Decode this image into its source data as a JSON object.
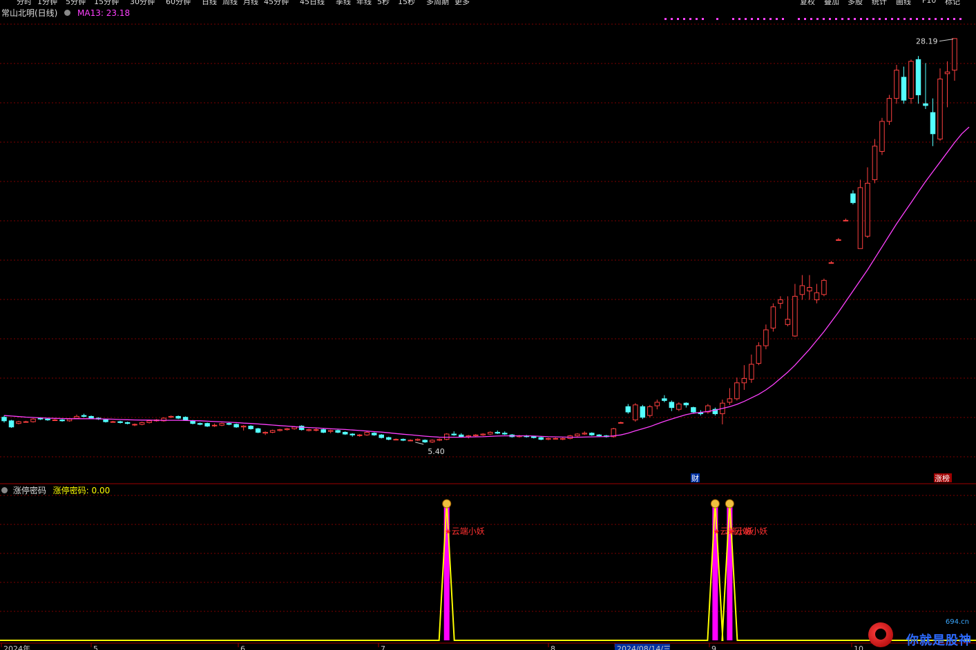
{
  "menu": {
    "items": [
      "分时",
      "1分钟",
      "5分钟",
      "15分钟",
      "30分钟",
      "60分钟",
      "日线",
      "周线",
      "月线",
      "45分钟",
      "45日线",
      "季线",
      "年线",
      "5秒",
      "15秒",
      "多周期",
      "更多"
    ],
    "right_buttons": [
      "复权",
      "叠加",
      "多股",
      "统计",
      "画线",
      "F10",
      "标记"
    ]
  },
  "header": {
    "stock_name": "常山北明(日线)",
    "ma_label": "MA13: 23.18"
  },
  "sub_panel": {
    "name": "涨停密码",
    "value_label": "涨停密码: 0.00"
  },
  "watermark": {
    "url": "694.cn",
    "text": "你就是股神"
  },
  "chart_data": [
    {
      "type": "candlestick",
      "title": "常山北明(日线)",
      "indicator": {
        "name": "MA13",
        "value": 23.18,
        "color": "#ff40ff"
      },
      "ylim": [
        4.2,
        29.2
      ],
      "grid": true,
      "colors": {
        "up": "#ff4040",
        "down": "#54ffff",
        "ma": "#ff40ff",
        "grid": "#800000"
      },
      "annotations": {
        "high": "28.19",
        "low": "5.40",
        "event_1": "财",
        "event_2": "涨榜"
      },
      "x_ticks": [
        "2024年",
        "5",
        "6",
        "7",
        "8",
        "2024/08/14/三",
        "9",
        "10"
      ],
      "candles": [
        [
          6.75,
          6.85,
          6.45,
          6.55
        ],
        [
          6.55,
          6.6,
          6.15,
          6.2
        ],
        [
          6.4,
          6.55,
          6.35,
          6.5
        ],
        [
          6.5,
          6.55,
          6.45,
          6.5
        ],
        [
          6.5,
          6.7,
          6.45,
          6.65
        ],
        [
          6.7,
          6.75,
          6.6,
          6.65
        ],
        [
          6.65,
          6.7,
          6.55,
          6.6
        ],
        [
          6.6,
          6.65,
          6.55,
          6.6
        ],
        [
          6.6,
          6.65,
          6.5,
          6.55
        ],
        [
          6.55,
          6.7,
          6.5,
          6.65
        ],
        [
          6.7,
          6.9,
          6.65,
          6.8
        ],
        [
          6.85,
          6.95,
          6.75,
          6.8
        ],
        [
          6.8,
          6.85,
          6.65,
          6.7
        ],
        [
          6.7,
          6.75,
          6.6,
          6.65
        ],
        [
          6.6,
          6.65,
          6.45,
          6.5
        ],
        [
          6.5,
          6.55,
          6.45,
          6.5
        ],
        [
          6.5,
          6.55,
          6.4,
          6.45
        ],
        [
          6.45,
          6.5,
          6.35,
          6.4
        ],
        [
          6.35,
          6.4,
          6.25,
          6.35
        ],
        [
          6.35,
          6.5,
          6.3,
          6.45
        ],
        [
          6.45,
          6.6,
          6.4,
          6.55
        ],
        [
          6.55,
          6.65,
          6.5,
          6.6
        ],
        [
          6.55,
          6.75,
          6.5,
          6.7
        ],
        [
          6.75,
          6.85,
          6.7,
          6.8
        ],
        [
          6.8,
          6.85,
          6.65,
          6.7
        ],
        [
          6.75,
          6.8,
          6.55,
          6.6
        ],
        [
          6.55,
          6.6,
          6.35,
          6.4
        ],
        [
          6.4,
          6.45,
          6.3,
          6.35
        ],
        [
          6.4,
          6.45,
          6.2,
          6.25
        ],
        [
          6.3,
          6.4,
          6.2,
          6.3
        ],
        [
          6.3,
          6.45,
          6.25,
          6.4
        ],
        [
          6.4,
          6.45,
          6.3,
          6.35
        ],
        [
          6.35,
          6.4,
          6.15,
          6.2
        ],
        [
          6.2,
          6.3,
          6.0,
          6.25
        ],
        [
          6.25,
          6.3,
          6.05,
          6.1
        ],
        [
          6.1,
          6.15,
          5.85,
          5.9
        ],
        [
          5.85,
          5.95,
          5.75,
          5.9
        ],
        [
          5.9,
          6.05,
          5.85,
          6.0
        ],
        [
          6.0,
          6.1,
          5.95,
          6.05
        ],
        [
          6.05,
          6.15,
          6.0,
          6.1
        ],
        [
          6.1,
          6.25,
          6.05,
          6.2
        ],
        [
          6.25,
          6.3,
          6.0,
          6.05
        ],
        [
          6.0,
          6.1,
          5.95,
          6.05
        ],
        [
          6.05,
          6.15,
          5.95,
          6.05
        ],
        [
          6.05,
          6.1,
          5.85,
          5.9
        ],
        [
          5.95,
          6.05,
          5.85,
          6.0
        ],
        [
          6.0,
          6.05,
          5.85,
          5.9
        ],
        [
          5.9,
          5.95,
          5.75,
          5.8
        ],
        [
          5.8,
          5.85,
          5.65,
          5.75
        ],
        [
          5.75,
          5.8,
          5.65,
          5.75
        ],
        [
          5.75,
          5.95,
          5.7,
          5.9
        ],
        [
          5.85,
          5.9,
          5.7,
          5.75
        ],
        [
          5.75,
          5.8,
          5.55,
          5.6
        ],
        [
          5.6,
          5.65,
          5.45,
          5.5
        ],
        [
          5.5,
          5.55,
          5.45,
          5.5
        ],
        [
          5.5,
          5.55,
          5.4,
          5.45
        ],
        [
          5.45,
          5.5,
          5.4,
          5.45
        ],
        [
          5.45,
          5.55,
          5.4,
          5.5
        ],
        [
          5.45,
          5.5,
          5.3,
          5.35
        ],
        [
          5.35,
          5.5,
          5.3,
          5.45
        ],
        [
          5.45,
          5.55,
          5.4,
          5.5
        ],
        [
          5.5,
          5.85,
          5.45,
          5.8
        ],
        [
          5.8,
          5.95,
          5.7,
          5.75
        ],
        [
          5.75,
          5.85,
          5.6,
          5.65
        ],
        [
          5.65,
          5.75,
          5.55,
          5.7
        ],
        [
          5.7,
          5.8,
          5.65,
          5.75
        ],
        [
          5.75,
          5.85,
          5.7,
          5.8
        ],
        [
          5.8,
          5.95,
          5.75,
          5.9
        ],
        [
          5.9,
          6.0,
          5.8,
          5.85
        ],
        [
          5.85,
          5.95,
          5.75,
          5.8
        ],
        [
          5.75,
          5.8,
          5.6,
          5.65
        ],
        [
          5.65,
          5.75,
          5.6,
          5.7
        ],
        [
          5.7,
          5.75,
          5.6,
          5.65
        ],
        [
          5.65,
          5.7,
          5.55,
          5.6
        ],
        [
          5.6,
          5.65,
          5.45,
          5.5
        ],
        [
          5.5,
          5.6,
          5.45,
          5.55
        ],
        [
          5.55,
          5.6,
          5.5,
          5.55
        ],
        [
          5.5,
          5.6,
          5.45,
          5.55
        ],
        [
          5.55,
          5.75,
          5.5,
          5.7
        ],
        [
          5.7,
          5.85,
          5.65,
          5.8
        ],
        [
          5.8,
          5.95,
          5.75,
          5.85
        ],
        [
          5.85,
          5.9,
          5.7,
          5.75
        ],
        [
          5.75,
          5.8,
          5.65,
          5.7
        ],
        [
          5.7,
          5.75,
          5.6,
          5.65
        ],
        [
          5.65,
          6.15,
          5.6,
          6.1
        ],
        [
          6.45,
          6.5,
          6.4,
          6.45
        ],
        [
          7.35,
          7.5,
          6.95,
          7.05
        ],
        [
          6.6,
          7.55,
          6.5,
          7.45
        ],
        [
          7.35,
          7.45,
          6.65,
          6.75
        ],
        [
          6.85,
          7.45,
          6.75,
          7.35
        ],
        [
          7.4,
          7.75,
          7.2,
          7.6
        ],
        [
          7.8,
          8.0,
          7.6,
          7.7
        ],
        [
          7.6,
          7.7,
          7.1,
          7.3
        ],
        [
          7.2,
          7.6,
          7.1,
          7.5
        ],
        [
          7.55,
          7.6,
          7.3,
          7.45
        ],
        [
          7.3,
          7.35,
          6.95,
          7.05
        ],
        [
          7.0,
          7.15,
          6.85,
          6.95
        ],
        [
          7.05,
          7.5,
          6.95,
          7.4
        ],
        [
          7.2,
          7.3,
          6.85,
          6.95
        ],
        [
          6.95,
          7.75,
          6.35,
          7.55
        ],
        [
          7.6,
          8.4,
          7.45,
          7.8
        ],
        [
          7.8,
          9.0,
          7.7,
          8.7
        ],
        [
          8.7,
          9.7,
          8.3,
          8.95
        ],
        [
          8.9,
          10.3,
          8.7,
          9.75
        ],
        [
          9.8,
          11.0,
          9.7,
          10.8
        ],
        [
          10.8,
          12.0,
          10.6,
          11.7
        ],
        [
          11.8,
          13.2,
          11.6,
          13.0
        ],
        [
          13.2,
          13.6,
          12.9,
          13.4
        ],
        [
          12.0,
          13.6,
          11.9,
          12.3
        ],
        [
          11.35,
          14.3,
          11.3,
          13.6
        ],
        [
          13.7,
          14.8,
          13.4,
          14.2
        ],
        [
          13.9,
          14.8,
          13.4,
          14.1
        ],
        [
          13.4,
          14.3,
          13.2,
          13.8
        ],
        [
          13.7,
          14.6,
          13.6,
          14.5
        ],
        [
          15.5,
          15.6,
          15.45,
          15.5
        ],
        [
          16.8,
          16.9,
          16.75,
          16.8
        ],
        [
          17.9,
          18.0,
          17.85,
          17.9
        ],
        [
          19.4,
          19.6,
          18.8,
          18.9
        ],
        [
          16.3,
          20.2,
          16.3,
          19.75
        ],
        [
          17.0,
          20.9,
          16.9,
          20.0
        ],
        [
          20.2,
          22.5,
          20.0,
          22.1
        ],
        [
          21.8,
          23.7,
          21.6,
          23.5
        ],
        [
          23.5,
          25.0,
          23.3,
          24.8
        ],
        [
          24.8,
          26.7,
          24.5,
          26.4
        ],
        [
          26.0,
          26.6,
          24.5,
          24.7
        ],
        [
          24.8,
          27.0,
          24.5,
          26.9
        ],
        [
          27.0,
          27.2,
          24.5,
          25.0
        ],
        [
          24.5,
          26.8,
          24.2,
          24.4
        ],
        [
          24.0,
          24.8,
          22.1,
          22.8
        ],
        [
          22.5,
          26.5,
          22.4,
          25.9
        ],
        [
          26.2,
          26.9,
          24.3,
          26.3
        ],
        [
          26.4,
          28.2,
          25.8,
          28.19
        ]
      ],
      "ma13": [
        6.85,
        6.82,
        6.79,
        6.76,
        6.74,
        6.72,
        6.7,
        6.69,
        6.68,
        6.67,
        6.67,
        6.67,
        6.67,
        6.66,
        6.65,
        6.64,
        6.62,
        6.61,
        6.6,
        6.59,
        6.59,
        6.58,
        6.58,
        6.58,
        6.58,
        6.57,
        6.56,
        6.55,
        6.53,
        6.51,
        6.49,
        6.47,
        6.45,
        6.42,
        6.4,
        6.37,
        6.34,
        6.31,
        6.28,
        6.25,
        6.22,
        6.19,
        6.17,
        6.15,
        6.12,
        6.1,
        6.08,
        6.06,
        6.03,
        6.0,
        5.97,
        5.94,
        5.91,
        5.87,
        5.83,
        5.79,
        5.76,
        5.72,
        5.68,
        5.65,
        5.62,
        5.62,
        5.62,
        5.62,
        5.63,
        5.64,
        5.65,
        5.67,
        5.69,
        5.7,
        5.7,
        5.7,
        5.7,
        5.69,
        5.67,
        5.65,
        5.64,
        5.63,
        5.62,
        5.62,
        5.63,
        5.64,
        5.65,
        5.66,
        5.7,
        5.75,
        5.85,
        5.98,
        6.1,
        6.22,
        6.37,
        6.52,
        6.65,
        6.78,
        6.9,
        6.98,
        7.03,
        7.08,
        7.15,
        7.25,
        7.35,
        7.48,
        7.65,
        7.85,
        8.05,
        8.3,
        8.6,
        8.95,
        9.3,
        9.7,
        10.15,
        10.6,
        11.1,
        11.6,
        12.15,
        12.7,
        13.3,
        13.9,
        14.5,
        15.1,
        15.75,
        16.4,
        17.05,
        17.7,
        18.3,
        18.9,
        19.5,
        20.1,
        20.65,
        21.2,
        21.75,
        22.3,
        22.8,
        23.18
      ]
    },
    {
      "type": "line",
      "title": "涨停密码",
      "ylim": [
        0,
        100
      ],
      "indicator": {
        "name": "涨停密码",
        "value": 0.0
      },
      "colors": {
        "line": "#ffff00",
        "bar": "#ff00ff"
      },
      "signals": [
        {
          "bar": 61,
          "value": 100,
          "label": "云端小妖"
        },
        {
          "bar": 98,
          "value": 100,
          "label": "云端小妖"
        },
        {
          "bar": 100,
          "value": 100,
          "label": "云端小妖"
        }
      ]
    }
  ]
}
